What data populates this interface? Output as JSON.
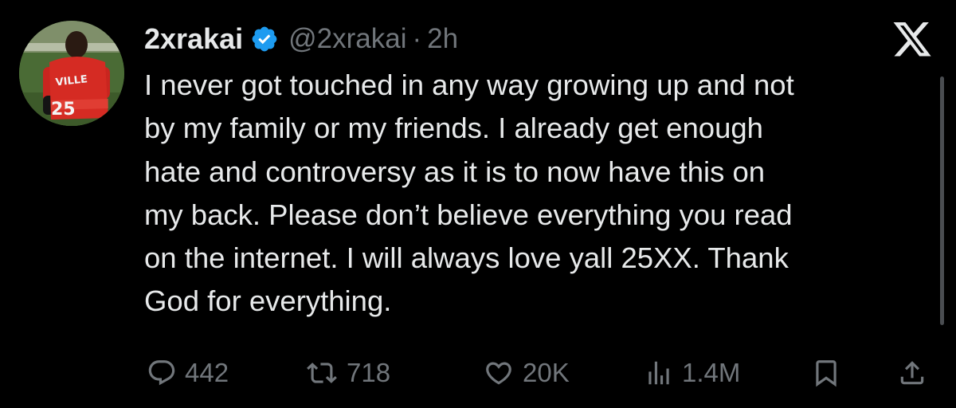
{
  "header": {
    "display_name": "2xrakai",
    "handle": "@2xrakai",
    "separator": "·",
    "time": "2h"
  },
  "tweet": {
    "text": "I never got touched in any way growing up and not\nby my family or my friends. I already get enough\nhate and controversy as it is to now have this on\nmy back. Please don’t believe everything you read\non the internet. I will always love yall 25XX. Thank\nGod for everything."
  },
  "avatar": {
    "jersey_text": "VILLE",
    "jersey_number": "25"
  },
  "actions": {
    "replies": "442",
    "reposts": "718",
    "likes": "20K",
    "views": "1.4M"
  },
  "colors": {
    "background": "#000000",
    "text": "#e7e9ea",
    "secondary": "#71767b",
    "verified_badge": "#1d9bf0"
  },
  "icons": [
    "verified-badge-icon",
    "x-logo-icon",
    "reply-icon",
    "repost-icon",
    "like-icon",
    "views-icon",
    "bookmark-icon",
    "share-icon"
  ]
}
